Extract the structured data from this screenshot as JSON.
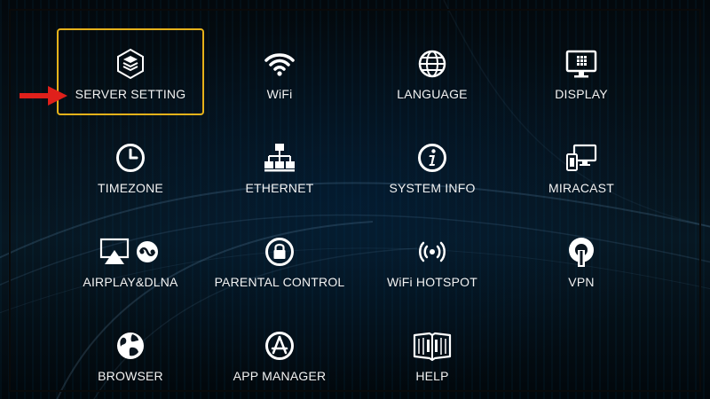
{
  "menu": {
    "items": [
      {
        "label": "SERVER SETTING",
        "icon": "server-icon",
        "selected": true
      },
      {
        "label": "WiFi",
        "icon": "wifi-icon",
        "selected": false
      },
      {
        "label": "LANGUAGE",
        "icon": "globe-icon",
        "selected": false
      },
      {
        "label": "DISPLAY",
        "icon": "monitor-icon",
        "selected": false
      },
      {
        "label": "TIMEZONE",
        "icon": "clock-icon",
        "selected": false
      },
      {
        "label": "ETHERNET",
        "icon": "network-icon",
        "selected": false
      },
      {
        "label": "SYSTEM INFO",
        "icon": "info-icon",
        "selected": false
      },
      {
        "label": "MIRACAST",
        "icon": "devices-icon",
        "selected": false
      },
      {
        "label": "AIRPLAY&DLNA",
        "icon": "airplay-icon",
        "selected": false
      },
      {
        "label": "PARENTAL CONTROL",
        "icon": "lock-icon",
        "selected": false
      },
      {
        "label": "WiFi HOTSPOT",
        "icon": "hotspot-icon",
        "selected": false
      },
      {
        "label": "VPN",
        "icon": "vpn-icon",
        "selected": false
      },
      {
        "label": "BROWSER",
        "icon": "browser-globe-icon",
        "selected": false
      },
      {
        "label": "APP MANAGER",
        "icon": "app-store-icon",
        "selected": false
      },
      {
        "label": "HELP",
        "icon": "book-icon",
        "selected": false
      }
    ]
  },
  "colors": {
    "selection_border": "#e6b21a",
    "pointer_arrow": "#e0201b",
    "label_text": "#f2f2f2"
  }
}
